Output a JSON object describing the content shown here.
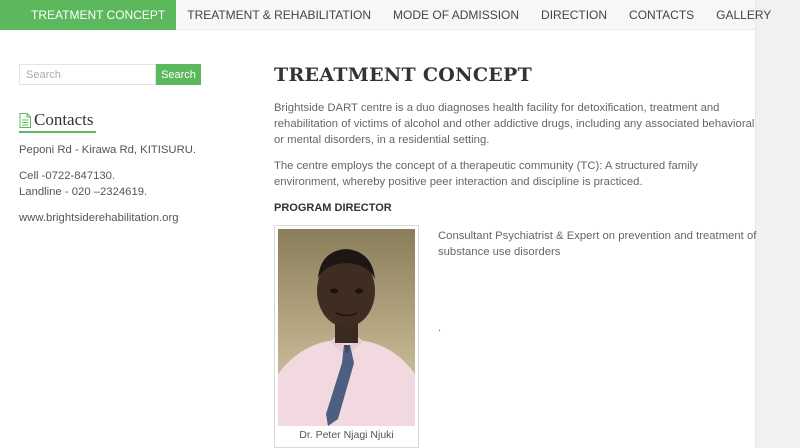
{
  "nav": {
    "items": [
      {
        "label": "TREATMENT CONCEPT",
        "active": true
      },
      {
        "label": "TREATMENT & REHABILITATION",
        "active": false
      },
      {
        "label": "MODE OF ADMISSION",
        "active": false
      },
      {
        "label": "DIRECTION",
        "active": false
      },
      {
        "label": "CONTACTS",
        "active": false
      },
      {
        "label": "GALLERY",
        "active": false
      }
    ]
  },
  "sidebar": {
    "search": {
      "placeholder": "Search",
      "button_label": "Search"
    },
    "contacts": {
      "title": "Contacts",
      "address": "Peponi Rd - Kirawa Rd, KITISURU.",
      "cell": "Cell -0722-847130.",
      "landline": "Landline - 020 –2324619.",
      "website": "www.brightsiderehabilitation.org"
    }
  },
  "main": {
    "title": "TREATMENT CONCEPT",
    "paragraph_1": "Brightside DART centre is a duo diagnoses health facility for detoxification, treatment and rehabilitation of victims of alcohol and other addictive drugs, including any associated behavioral or mental disorders, in a residential setting.",
    "paragraph_2": "The centre employs the concept of a therapeutic community (TC): A structured family environment, whereby positive peer interaction and discipline is practiced.",
    "program_director_heading": "PROGRAM DIRECTOR",
    "director_caption": "Dr. Peter Njagi  Njuki",
    "director_bio": "Consultant Psychiatrist & Expert on prevention and treatment of substance use disorders",
    "trailing_text": "."
  },
  "colors": {
    "accent": "#5cb85c",
    "nav_bg": "#f7f7f7",
    "text": "#555555",
    "heading": "#333333"
  },
  "icons": {
    "contacts_heading": "document-icon"
  }
}
